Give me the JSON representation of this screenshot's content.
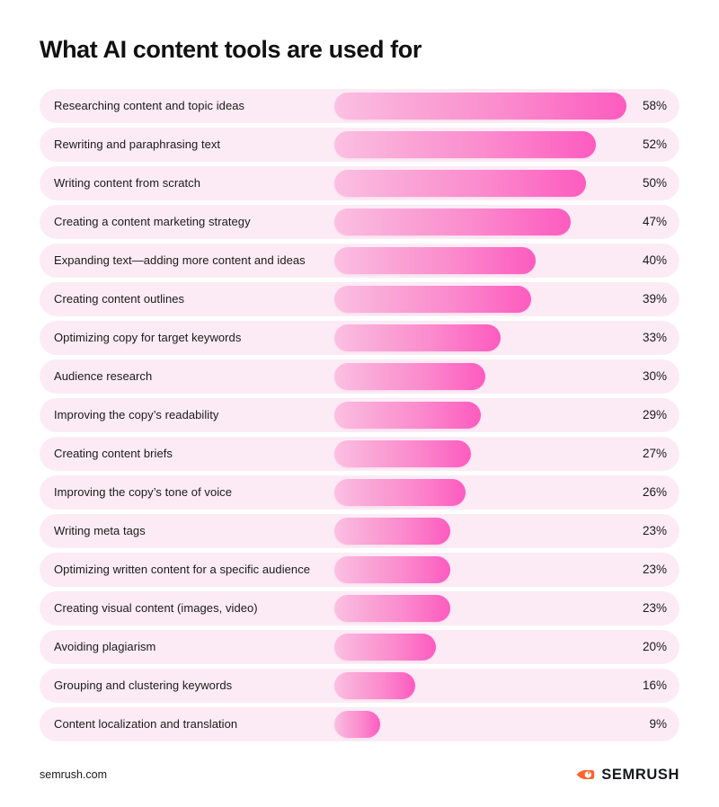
{
  "title": "What AI content tools are used for",
  "footer": {
    "url": "semrush.com",
    "brand_name": "SEMRUSH",
    "brand_icon": "semrush-comet-icon",
    "brand_color": "#FF642D"
  },
  "colors": {
    "track": "#FCEBF5",
    "bar_gradient_start": "#FBC0E2",
    "bar_gradient_end": "#FD5CBF",
    "text": "#1A1A1A",
    "title": "#111111",
    "background": "#FFFFFF"
  },
  "chart_data": {
    "type": "bar",
    "orientation": "horizontal",
    "title": "What AI content tools are used for",
    "xlabel": "",
    "ylabel": "",
    "xlim": [
      0,
      58
    ],
    "grid": false,
    "legend": null,
    "value_suffix": "%",
    "categories": [
      "Researching content and topic ideas",
      "Rewriting and paraphrasing text",
      "Writing content from scratch",
      "Creating a content marketing strategy",
      "Expanding text—adding more content and ideas",
      "Creating content outlines",
      "Optimizing copy for target keywords",
      "Audience research",
      "Improving the copy’s readability",
      "Creating content briefs",
      "Improving the copy’s tone of voice",
      "Writing meta tags",
      "Optimizing written content for a specific audience",
      "Creating visual content (images, video)",
      "Avoiding plagiarism",
      "Grouping and clustering keywords",
      "Content localization and translation"
    ],
    "values": [
      58,
      52,
      50,
      47,
      40,
      39,
      33,
      30,
      29,
      27,
      26,
      23,
      23,
      23,
      20,
      16,
      9
    ],
    "value_labels": [
      "58%",
      "52%",
      "50%",
      "47%",
      "40%",
      "39%",
      "33%",
      "30%",
      "29%",
      "27%",
      "26%",
      "23%",
      "23%",
      "23%",
      "20%",
      "16%",
      "9%"
    ]
  }
}
